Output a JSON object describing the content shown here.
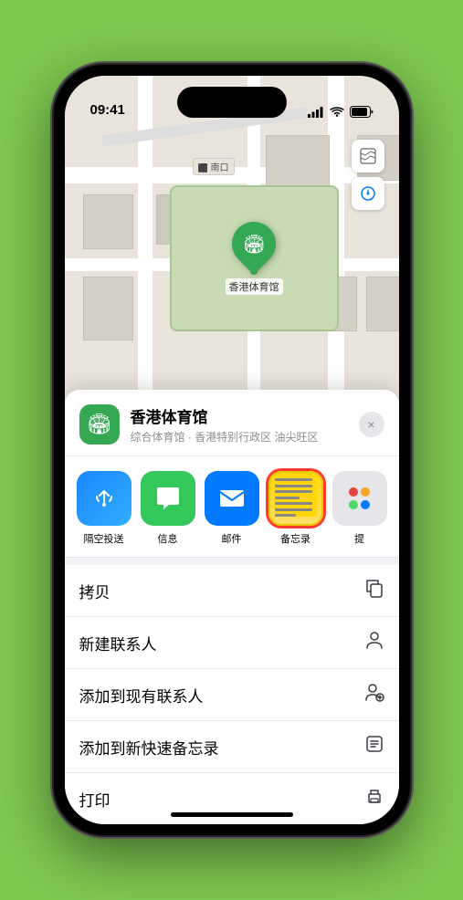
{
  "status_bar": {
    "time": "09:41",
    "location_arrow": "▶"
  },
  "map": {
    "label_south": "南口",
    "pin_label": "香港体育馆"
  },
  "location_header": {
    "name": "香港体育馆",
    "description": "综合体育馆 · 香港特别行政区 油尖旺区",
    "close_label": "×"
  },
  "share_apps": [
    {
      "id": "airdrop",
      "label": "隔空投送",
      "type": "airdrop"
    },
    {
      "id": "messages",
      "label": "信息",
      "type": "messages"
    },
    {
      "id": "mail",
      "label": "邮件",
      "type": "mail"
    },
    {
      "id": "notes",
      "label": "备忘录",
      "type": "notes",
      "selected": true
    },
    {
      "id": "more",
      "label": "提",
      "type": "more"
    }
  ],
  "menu_items": [
    {
      "id": "copy",
      "label": "拷贝",
      "icon": "copy"
    },
    {
      "id": "new-contact",
      "label": "新建联系人",
      "icon": "person"
    },
    {
      "id": "add-contact",
      "label": "添加到现有联系人",
      "icon": "person-add"
    },
    {
      "id": "quick-note",
      "label": "添加到新快速备忘录",
      "icon": "note"
    },
    {
      "id": "print",
      "label": "打印",
      "icon": "print"
    }
  ]
}
